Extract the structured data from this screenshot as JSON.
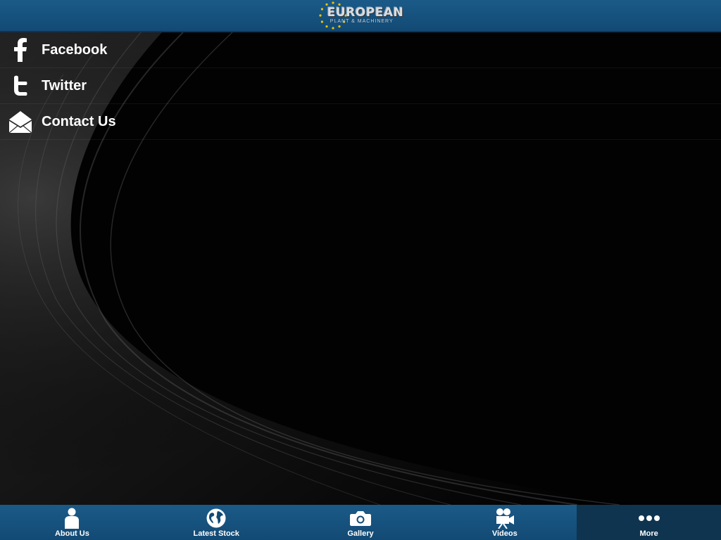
{
  "header": {
    "logo_main": "EUROPEAN",
    "logo_sub": "PLANT & MACHINERY",
    "colors": {
      "bar": "#124a74",
      "stars": "#f2c200"
    }
  },
  "menu": {
    "items": [
      {
        "label": "Facebook",
        "icon": "facebook-icon"
      },
      {
        "label": "Twitter",
        "icon": "twitter-icon"
      },
      {
        "label": "Contact Us",
        "icon": "envelope-icon"
      }
    ]
  },
  "tabbar": {
    "tabs": [
      {
        "label": "About Us",
        "icon": "person-icon",
        "active": false
      },
      {
        "label": "Latest Stock",
        "icon": "globe-icon",
        "active": false
      },
      {
        "label": "Gallery",
        "icon": "camera-icon",
        "active": false
      },
      {
        "label": "Videos",
        "icon": "video-camera-icon",
        "active": false
      },
      {
        "label": "More",
        "icon": "more-dots-icon",
        "active": true
      }
    ]
  }
}
